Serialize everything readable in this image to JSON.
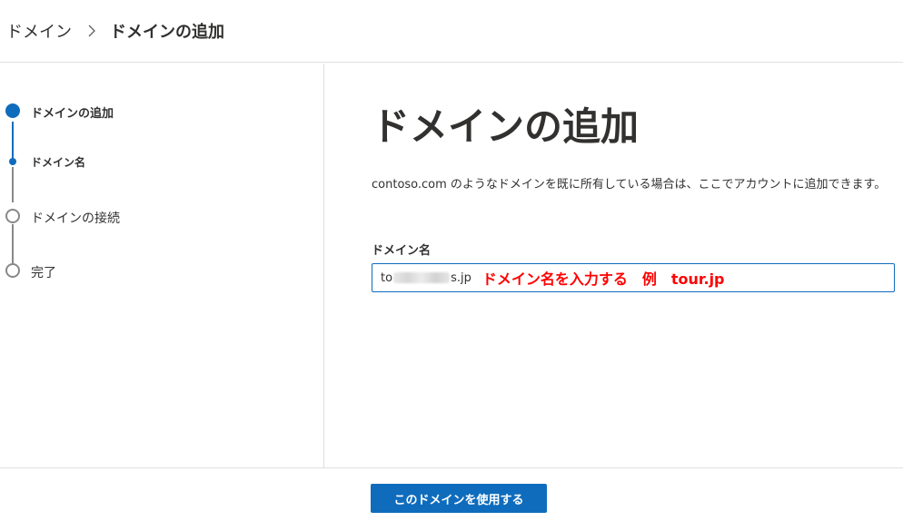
{
  "breadcrumb": {
    "parent": "ドメイン",
    "current": "ドメインの追加",
    "separator_icon": "chevron-right-icon"
  },
  "steps": [
    {
      "label": "ドメインの追加",
      "state": "current"
    },
    {
      "label": "ドメイン名",
      "state": "current-substep"
    },
    {
      "label": "ドメインの接続",
      "state": "pending"
    },
    {
      "label": "完了",
      "state": "pending"
    }
  ],
  "main": {
    "title": "ドメインの追加",
    "description": "contoso.com のようなドメインを既に所有している場合は、ここでアカウントに追加できます。",
    "field_label": "ドメイン名",
    "input_value_prefix": "to",
    "input_value_suffix": "s.jp",
    "annotation": "ドメイン名を入力する　例　tour.jp"
  },
  "footer": {
    "primary_button": "このドメインを使用する"
  },
  "colors": {
    "accent": "#0f6cbd",
    "annotation": "#ff0000",
    "text": "#323130",
    "divider": "#e1dfdd"
  }
}
